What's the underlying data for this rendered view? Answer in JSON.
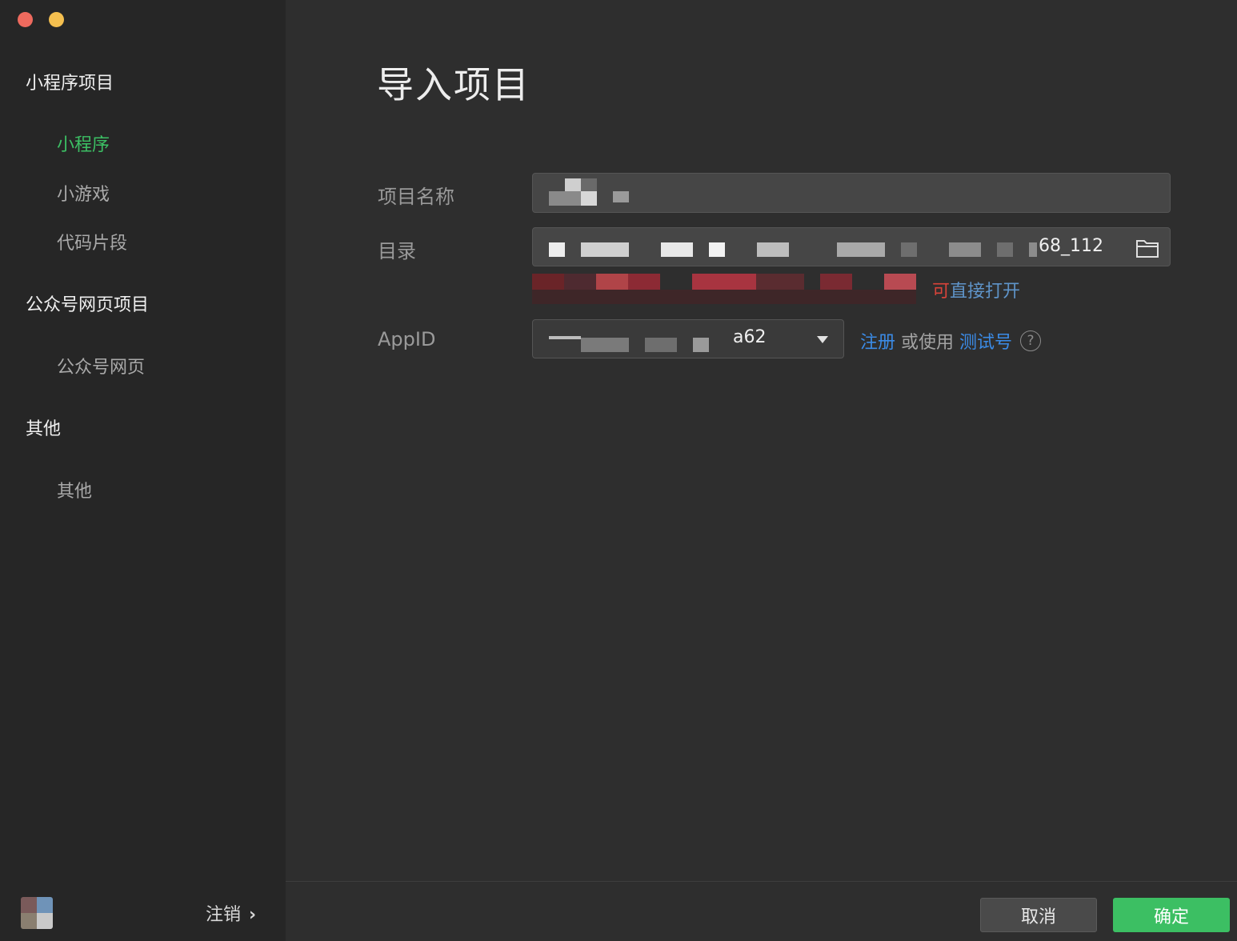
{
  "window": {
    "controls": [
      "close",
      "minimize"
    ]
  },
  "sidebar": {
    "sections": [
      {
        "title": "小程序项目",
        "items": [
          {
            "label": "小程序",
            "active": true
          },
          {
            "label": "小游戏",
            "active": false
          },
          {
            "label": "代码片段",
            "active": false
          }
        ]
      },
      {
        "title": "公众号网页项目",
        "items": [
          {
            "label": "公众号网页",
            "active": false
          }
        ]
      },
      {
        "title": "其他",
        "items": [
          {
            "label": "其他",
            "active": false
          }
        ]
      }
    ],
    "logout_label": "注销",
    "logout_chevron": "›"
  },
  "main": {
    "title": "导入项目",
    "form": {
      "project_name_label": "项目名称",
      "directory_label": "目录",
      "directory_value_visible": "68_112",
      "appid_label": "AppID",
      "appid_value_visible": "a62",
      "hint_red": "可",
      "hint_text": "直接打开",
      "register_link": "注册",
      "or_use": " 或使用 ",
      "test_account_link": "测试号",
      "help_icon": "?"
    },
    "buttons": {
      "cancel": "取消",
      "confirm": "确定"
    }
  },
  "colors": {
    "accent_green": "#3cc064",
    "link_blue": "#3b8be6",
    "error_red": "#d9443a",
    "sidebar_bg": "#262626",
    "main_bg": "#2e2e2e"
  }
}
